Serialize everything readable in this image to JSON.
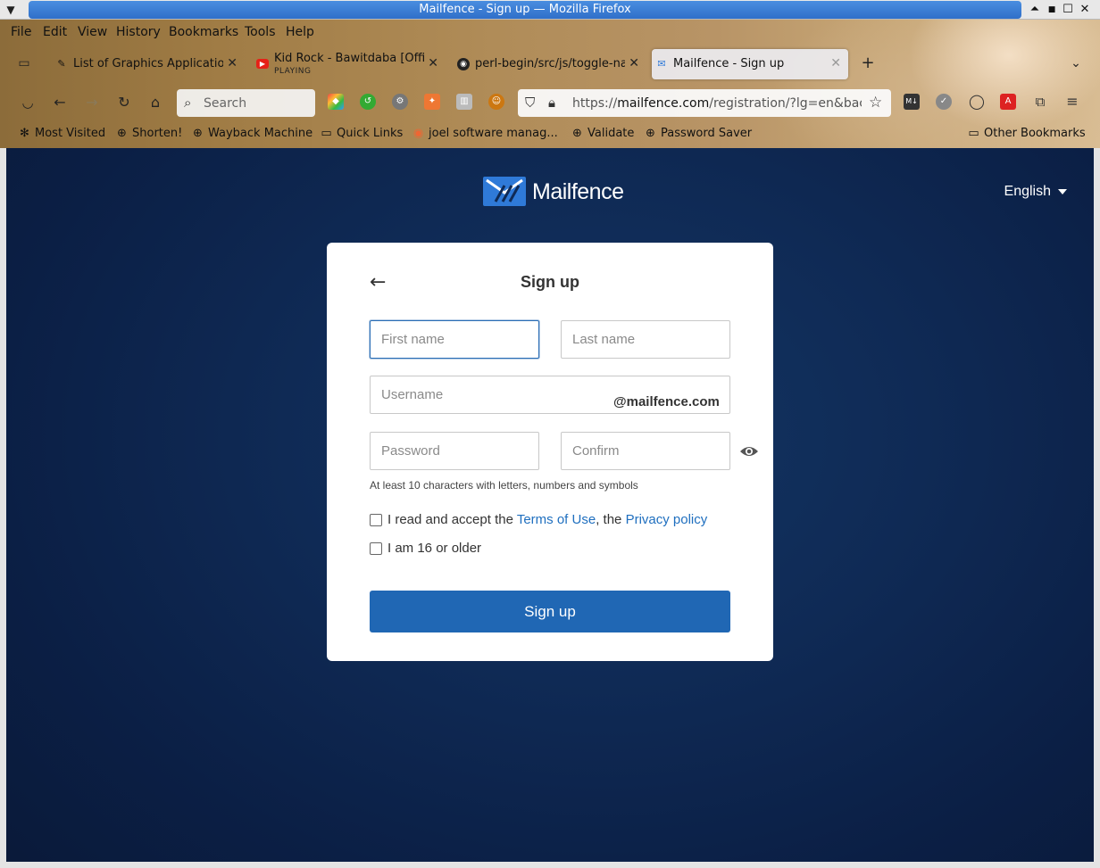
{
  "window": {
    "title": "Mailfence - Sign up — Mozilla Firefox"
  },
  "menu": {
    "items": [
      "File",
      "Edit",
      "View",
      "History",
      "Bookmarks",
      "Tools",
      "Help"
    ]
  },
  "tabs": [
    {
      "label": "List of Graphics Applicatior",
      "icon": "graphics-favicon"
    },
    {
      "label": "Kid Rock - Bawitdaba [Offic",
      "sublabel": "PLAYING",
      "icon": "youtube-favicon"
    },
    {
      "label": "perl-begin/src/js/toggle-na",
      "icon": "github-favicon"
    },
    {
      "label": "Mailfence - Sign up",
      "icon": "mailfence-favicon",
      "active": true
    }
  ],
  "nav": {
    "search_placeholder": "Search",
    "url_prefix": "https://",
    "url_domain": "mailfence.com",
    "url_rest": "/registration/?lg=en&back="
  },
  "bookmarks": [
    "Most Visited",
    "Shorten!",
    "Wayback Machine",
    "Quick Links",
    "joel software manag...",
    "Validate",
    "Password Saver"
  ],
  "other_bookmarks": "Other Bookmarks",
  "page": {
    "brand": "Mailfence",
    "language": "English",
    "heading": "Sign up",
    "first_name_placeholder": "First name",
    "last_name_placeholder": "Last name",
    "username_placeholder": "Username",
    "username_suffix": "@mailfence.com",
    "password_placeholder": "Password",
    "confirm_placeholder": "Confirm",
    "password_hint": "At least 10 characters with letters, numbers and symbols",
    "terms_prefix": "I read and accept the ",
    "terms_link": "Terms of Use",
    "terms_middle": ", the ",
    "privacy_link": "Privacy policy",
    "age_label": "I am 16 or older",
    "submit_label": "Sign up"
  },
  "colors": {
    "primary": "#2067b4",
    "link": "#1f6fbf",
    "page_bg": "#0f2a55"
  }
}
